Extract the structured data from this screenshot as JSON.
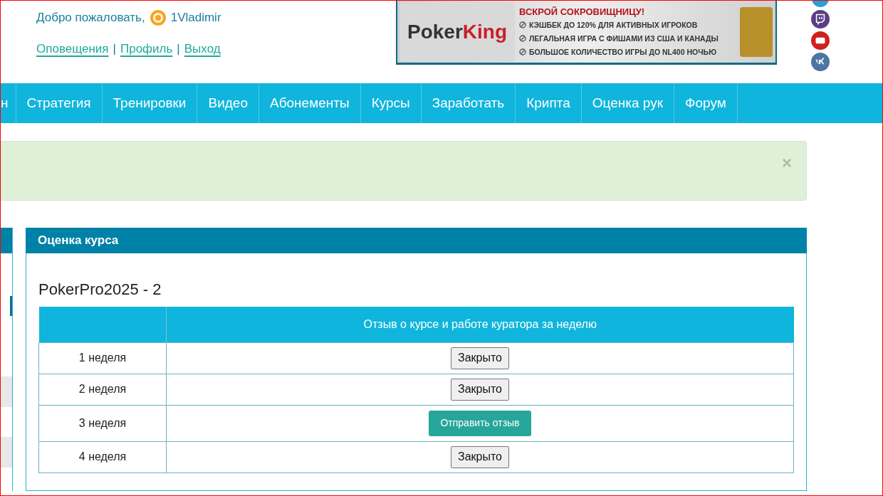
{
  "header": {
    "welcome": "Добро пожаловать,",
    "username": "1Vladimir",
    "links": [
      {
        "label": "Оповещения"
      },
      {
        "label": "Профиль"
      },
      {
        "label": "Выход"
      }
    ],
    "separator": "|"
  },
  "banner": {
    "logo_left": "Poker",
    "logo_right": "King",
    "headline": "ВСКРОЙ СОКРОВИЩНИЦУ!",
    "bullets": [
      "КЭШБЕК ДО 120% ДЛЯ АКТИВНЫХ ИГРОКОВ",
      "ЛЕГАЛЬНАЯ ИГРА С ФИШАМИ ИЗ США И КАНАДЫ",
      "БОЛЬШОЕ КОЛИЧЕСТВО ИГРЫ ДО NL400 НОЧЬЮ"
    ]
  },
  "social": [
    {
      "kind": "partial",
      "color": "#2a9fd6"
    },
    {
      "kind": "twitch",
      "color": "#5a3e85"
    },
    {
      "kind": "youtube",
      "color": "#d0201e"
    },
    {
      "kind": "vk",
      "color": "#4c75a3"
    }
  ],
  "nav": [
    {
      "label": "н"
    },
    {
      "label": "Стратегия"
    },
    {
      "label": "Тренировки"
    },
    {
      "label": "Видео"
    },
    {
      "label": "Абонементы"
    },
    {
      "label": "Курсы"
    },
    {
      "label": "Заработать"
    },
    {
      "label": "Крипта"
    },
    {
      "label": "Оценка рук"
    },
    {
      "label": "Форум"
    }
  ],
  "alert": {
    "close": "×"
  },
  "panel": {
    "title": "Оценка курса",
    "course": "PokerPro2025 - 2",
    "table": {
      "columns": [
        "Отзыв о курсе и работе куратора за неделю"
      ],
      "rows": [
        {
          "week": "1 неделя",
          "action": {
            "label": "Закрыто",
            "kind": "closed"
          }
        },
        {
          "week": "2 неделя",
          "action": {
            "label": "Закрыто",
            "kind": "closed"
          }
        },
        {
          "week": "3 неделя",
          "action": {
            "label": "Отправить отзыв",
            "kind": "send"
          }
        },
        {
          "week": "4 неделя",
          "action": {
            "label": "Закрыто",
            "kind": "closed"
          }
        }
      ]
    }
  }
}
